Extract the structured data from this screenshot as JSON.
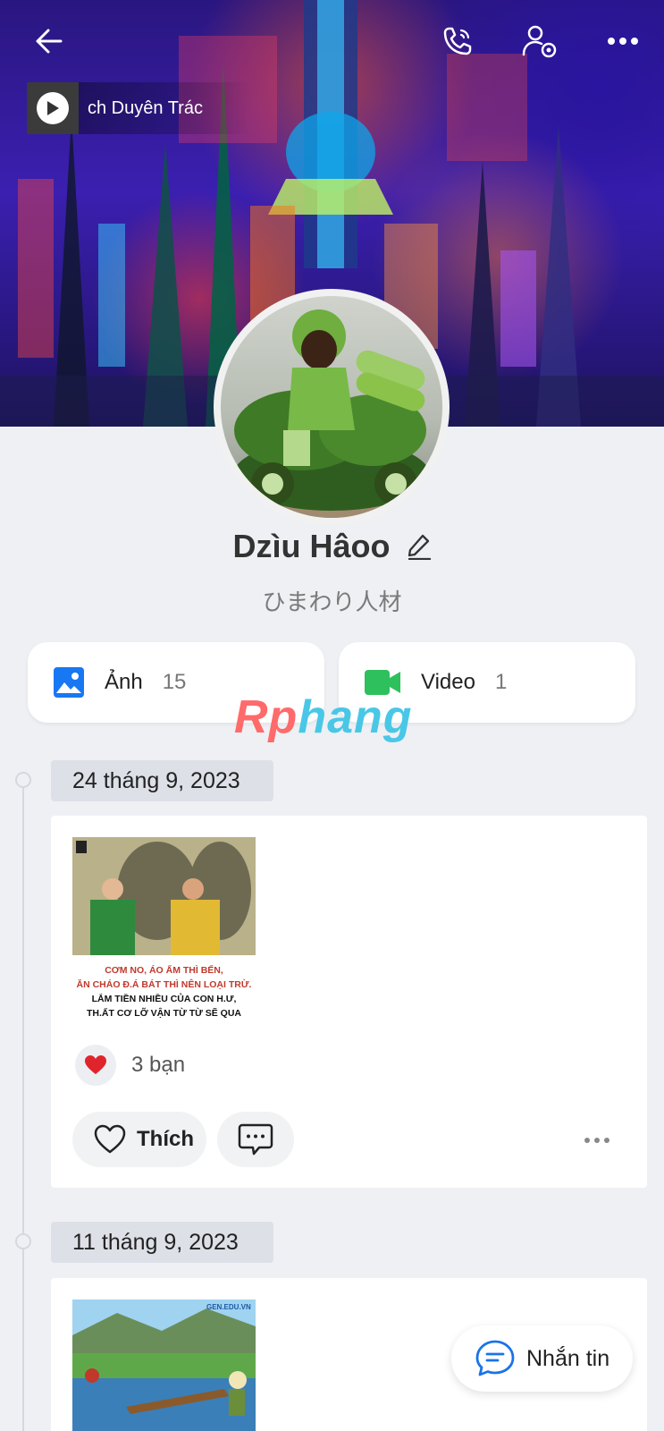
{
  "header": {
    "back_icon": "arrow-left-icon",
    "call_icon": "phone-icon",
    "settings_icon": "user-settings-icon",
    "more_icon": "more-horizontal-icon"
  },
  "music": {
    "title": "ch Duyên Trác",
    "icon": "play-icon"
  },
  "profile": {
    "name": "Dzìu Hâoo",
    "subtitle": "ひまわり人材",
    "edit_icon": "pencil-icon"
  },
  "media": {
    "photos": {
      "label": "Ảnh",
      "count": "15",
      "icon": "image-icon",
      "color": "#1877f2"
    },
    "videos": {
      "label": "Video",
      "count": "1",
      "icon": "video-camera-icon",
      "color": "#2ec05c"
    }
  },
  "watermark": {
    "part1": "Rp",
    "part2": "hang"
  },
  "posts": [
    {
      "date": "24 tháng 9, 2023",
      "image_caption_lines": [
        "CƠM NO, ÁO ẤM THÌ BẾN,",
        "ĂN CHÁO Đ.Á BÁT THÌ NÊN LOẠI TRỪ.",
        "LẮM TIỀN NHIỀU CỦA CON H.Ư,",
        "TH.ẤT CƠ LỠ VẬN TỪ TỪ SẼ QUA"
      ],
      "reaction_icon": "heart-red-icon",
      "reaction_text": "3 bạn",
      "like_label": "Thích"
    },
    {
      "date": "11 tháng 9, 2023",
      "image_watermark": "GEN.EDU.VN"
    }
  ],
  "fab": {
    "label": "Nhắn tin",
    "icon": "chat-bubble-icon",
    "color": "#1a73e8"
  }
}
